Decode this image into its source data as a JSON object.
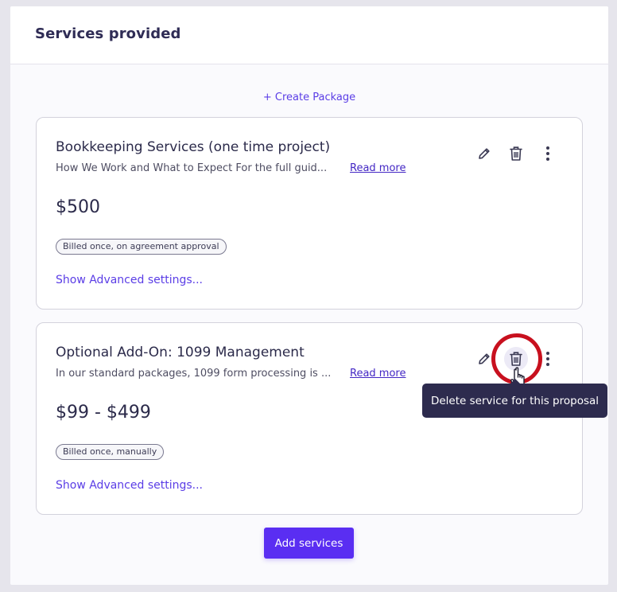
{
  "panel": {
    "title": "Services provided",
    "create_package_label": "+ Create Package",
    "add_services_label": "Add services"
  },
  "services": [
    {
      "title": "Bookkeeping Services (one time project)",
      "description": "How We Work and What to Expect For the full guid...",
      "read_more_label": "Read more",
      "price": "$500",
      "billing": "Billed once, on agreement approval",
      "advanced_label": "Show Advanced settings..."
    },
    {
      "title": "Optional Add-On: 1099 Management",
      "description": "In our standard packages, 1099 form processing is ...",
      "read_more_label": "Read more",
      "price": "$99 - $499",
      "billing": "Billed once, manually",
      "advanced_label": "Show Advanced settings..."
    }
  ],
  "tooltip": {
    "text": "Delete service for this proposal"
  },
  "icons": {
    "edit": "pencil-icon",
    "delete": "trash-icon",
    "more": "kebab-menu-icon"
  },
  "colors": {
    "accent": "#5a3de6",
    "button": "#5a2ef2",
    "tooltip_bg": "#2d2b4e",
    "highlight": "#c8101e"
  }
}
